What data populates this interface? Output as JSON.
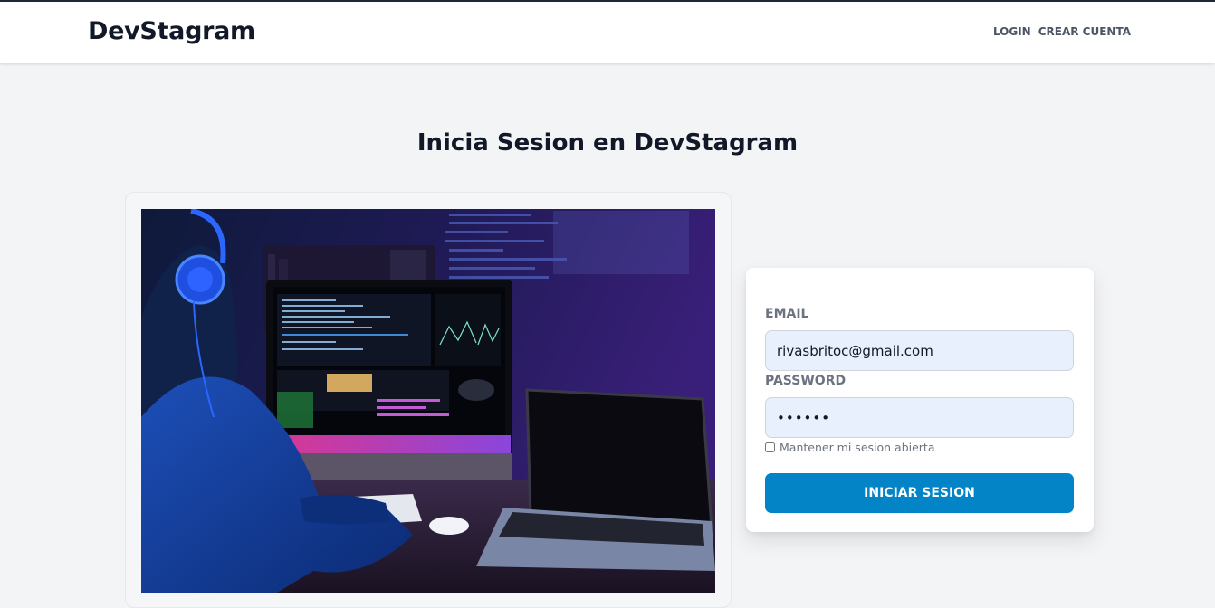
{
  "header": {
    "brand": "DevStagram",
    "nav": [
      {
        "label": "LOGIN"
      },
      {
        "label": "CREAR CUENTA"
      }
    ]
  },
  "page_title": "Inicia Sesion en DevStagram",
  "form": {
    "email_label": "EMAIL",
    "email_value": "rivasbritoc@gmail.com",
    "password_label": "PASSWORD",
    "password_value": "••••••",
    "remember_label": "Mantener mi sesion abierta",
    "submit_label": "INICIAR SESION"
  },
  "colors": {
    "accent": "#0284c7",
    "page_background": "#f3f4f6",
    "input_background": "#e8f0fe"
  }
}
